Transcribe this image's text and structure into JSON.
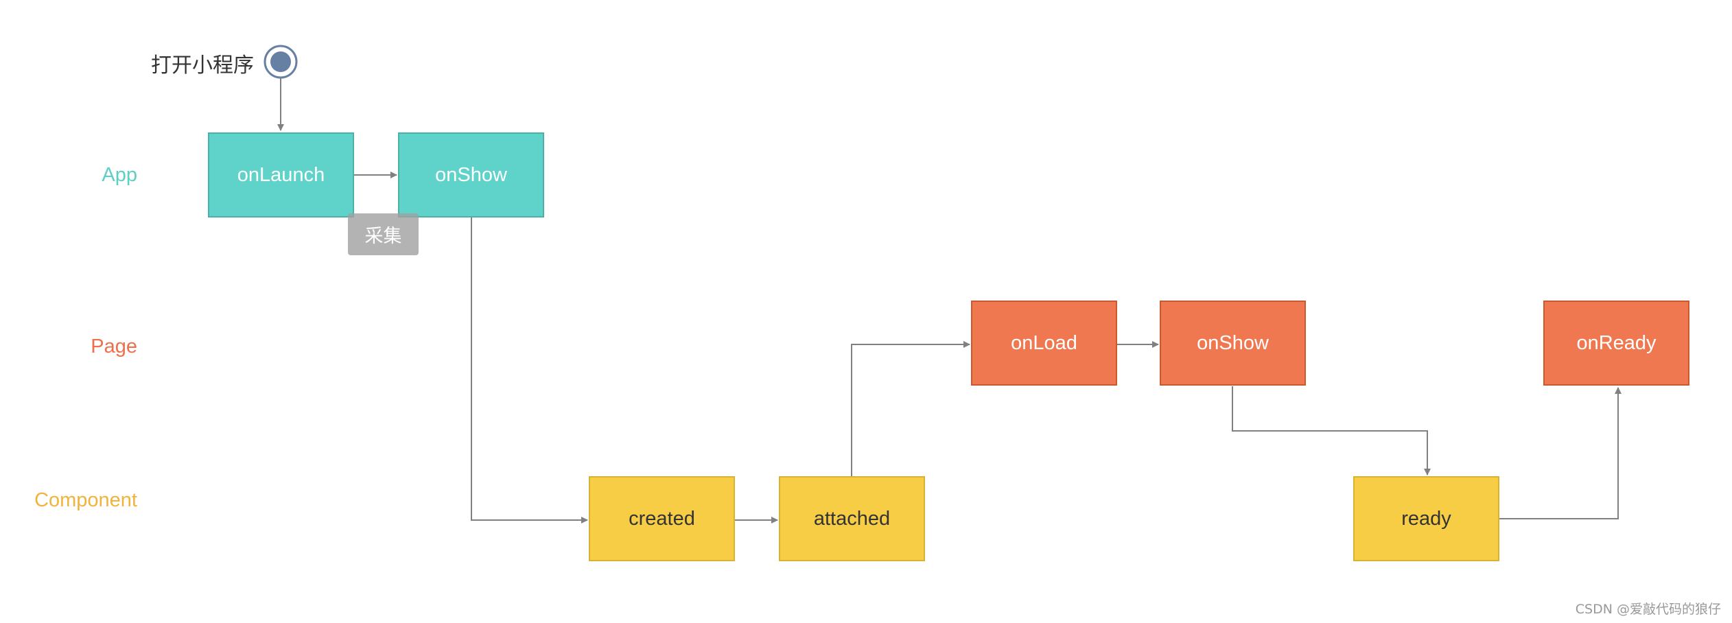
{
  "start": {
    "label": "打开小程序",
    "icon": "start-node-circle"
  },
  "lanes": {
    "app": "App",
    "page": "Page",
    "component": "Component"
  },
  "colors": {
    "app": "#5fd3c9",
    "page": "#f07850",
    "component": "#f6cd45",
    "app_label": "#5fcfc4",
    "page_label": "#ee6f4a",
    "component_label": "#f2b33d",
    "connector": "#808080"
  },
  "nodes": {
    "app_onLaunch": "onLaunch",
    "app_onShow": "onShow",
    "page_onLoad": "onLoad",
    "page_onShow": "onShow",
    "page_onReady": "onReady",
    "comp_created": "created",
    "comp_attached": "attached",
    "comp_ready": "ready"
  },
  "tooltip": "采集",
  "watermark": "CSDN @爱敲代码的狼仔"
}
